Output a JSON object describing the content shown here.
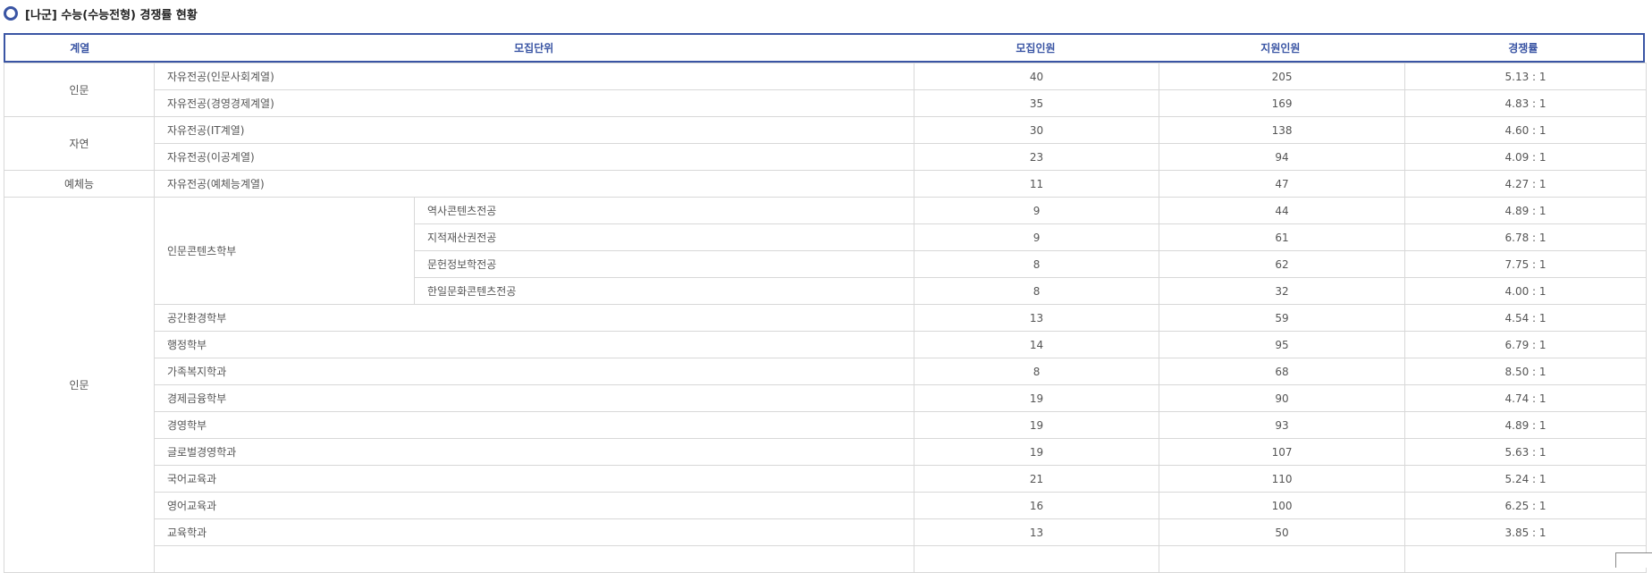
{
  "page": {
    "title": "[나군] 수능(수능전형) 경쟁률 현황"
  },
  "header": {
    "col1": "계열",
    "col2": "모집단위",
    "col3": "모집인원",
    "col4": "지원인원",
    "col5": "경쟁률"
  },
  "rows": [
    {
      "group": "인문",
      "unit": "자유전공(인문사회계열)",
      "sub": "",
      "recruit": "40",
      "apply": "205",
      "rate": "5.13 : 1"
    },
    {
      "group": "",
      "unit": "자유전공(경영경제계열)",
      "sub": "",
      "recruit": "35",
      "apply": "169",
      "rate": "4.83 : 1"
    },
    {
      "group": "자연",
      "unit": "자유전공(IT계열)",
      "sub": "",
      "recruit": "30",
      "apply": "138",
      "rate": "4.60 : 1"
    },
    {
      "group": "",
      "unit": "자유전공(이공계열)",
      "sub": "",
      "recruit": "23",
      "apply": "94",
      "rate": "4.09 : 1"
    },
    {
      "group": "예체능",
      "unit": "자유전공(예체능계열)",
      "sub": "",
      "recruit": "11",
      "apply": "47",
      "rate": "4.27 : 1"
    },
    {
      "group": "인문",
      "unit": "인문콘텐츠학부",
      "sub": "역사콘텐츠전공",
      "recruit": "9",
      "apply": "44",
      "rate": "4.89 : 1"
    },
    {
      "group": "",
      "unit": "",
      "sub": "지적재산권전공",
      "recruit": "9",
      "apply": "61",
      "rate": "6.78 : 1"
    },
    {
      "group": "",
      "unit": "",
      "sub": "문헌정보학전공",
      "recruit": "8",
      "apply": "62",
      "rate": "7.75 : 1"
    },
    {
      "group": "",
      "unit": "",
      "sub": "한일문화콘텐츠전공",
      "recruit": "8",
      "apply": "32",
      "rate": "4.00 : 1"
    },
    {
      "group": "",
      "unit": "공간환경학부",
      "sub": "",
      "recruit": "13",
      "apply": "59",
      "rate": "4.54 : 1"
    },
    {
      "group": "",
      "unit": "행정학부",
      "sub": "",
      "recruit": "14",
      "apply": "95",
      "rate": "6.79 : 1"
    },
    {
      "group": "",
      "unit": "가족복지학과",
      "sub": "",
      "recruit": "8",
      "apply": "68",
      "rate": "8.50 : 1"
    },
    {
      "group": "",
      "unit": "경제금융학부",
      "sub": "",
      "recruit": "19",
      "apply": "90",
      "rate": "4.74 : 1"
    },
    {
      "group": "",
      "unit": "경영학부",
      "sub": "",
      "recruit": "19",
      "apply": "93",
      "rate": "4.89 : 1"
    },
    {
      "group": "",
      "unit": "글로벌경영학과",
      "sub": "",
      "recruit": "19",
      "apply": "107",
      "rate": "5.63 : 1"
    },
    {
      "group": "",
      "unit": "국어교육과",
      "sub": "",
      "recruit": "21",
      "apply": "110",
      "rate": "5.24 : 1"
    },
    {
      "group": "",
      "unit": "영어교육과",
      "sub": "",
      "recruit": "16",
      "apply": "100",
      "rate": "6.25 : 1"
    },
    {
      "group": "",
      "unit": "교육학과",
      "sub": "",
      "recruit": "13",
      "apply": "50",
      "rate": "3.85 : 1"
    },
    {
      "group": "",
      "unit": "",
      "sub": "",
      "recruit": "",
      "apply": "",
      "rate": ""
    }
  ],
  "colors": {
    "accent": "#3a55a4",
    "border": "#d8d8d8"
  }
}
